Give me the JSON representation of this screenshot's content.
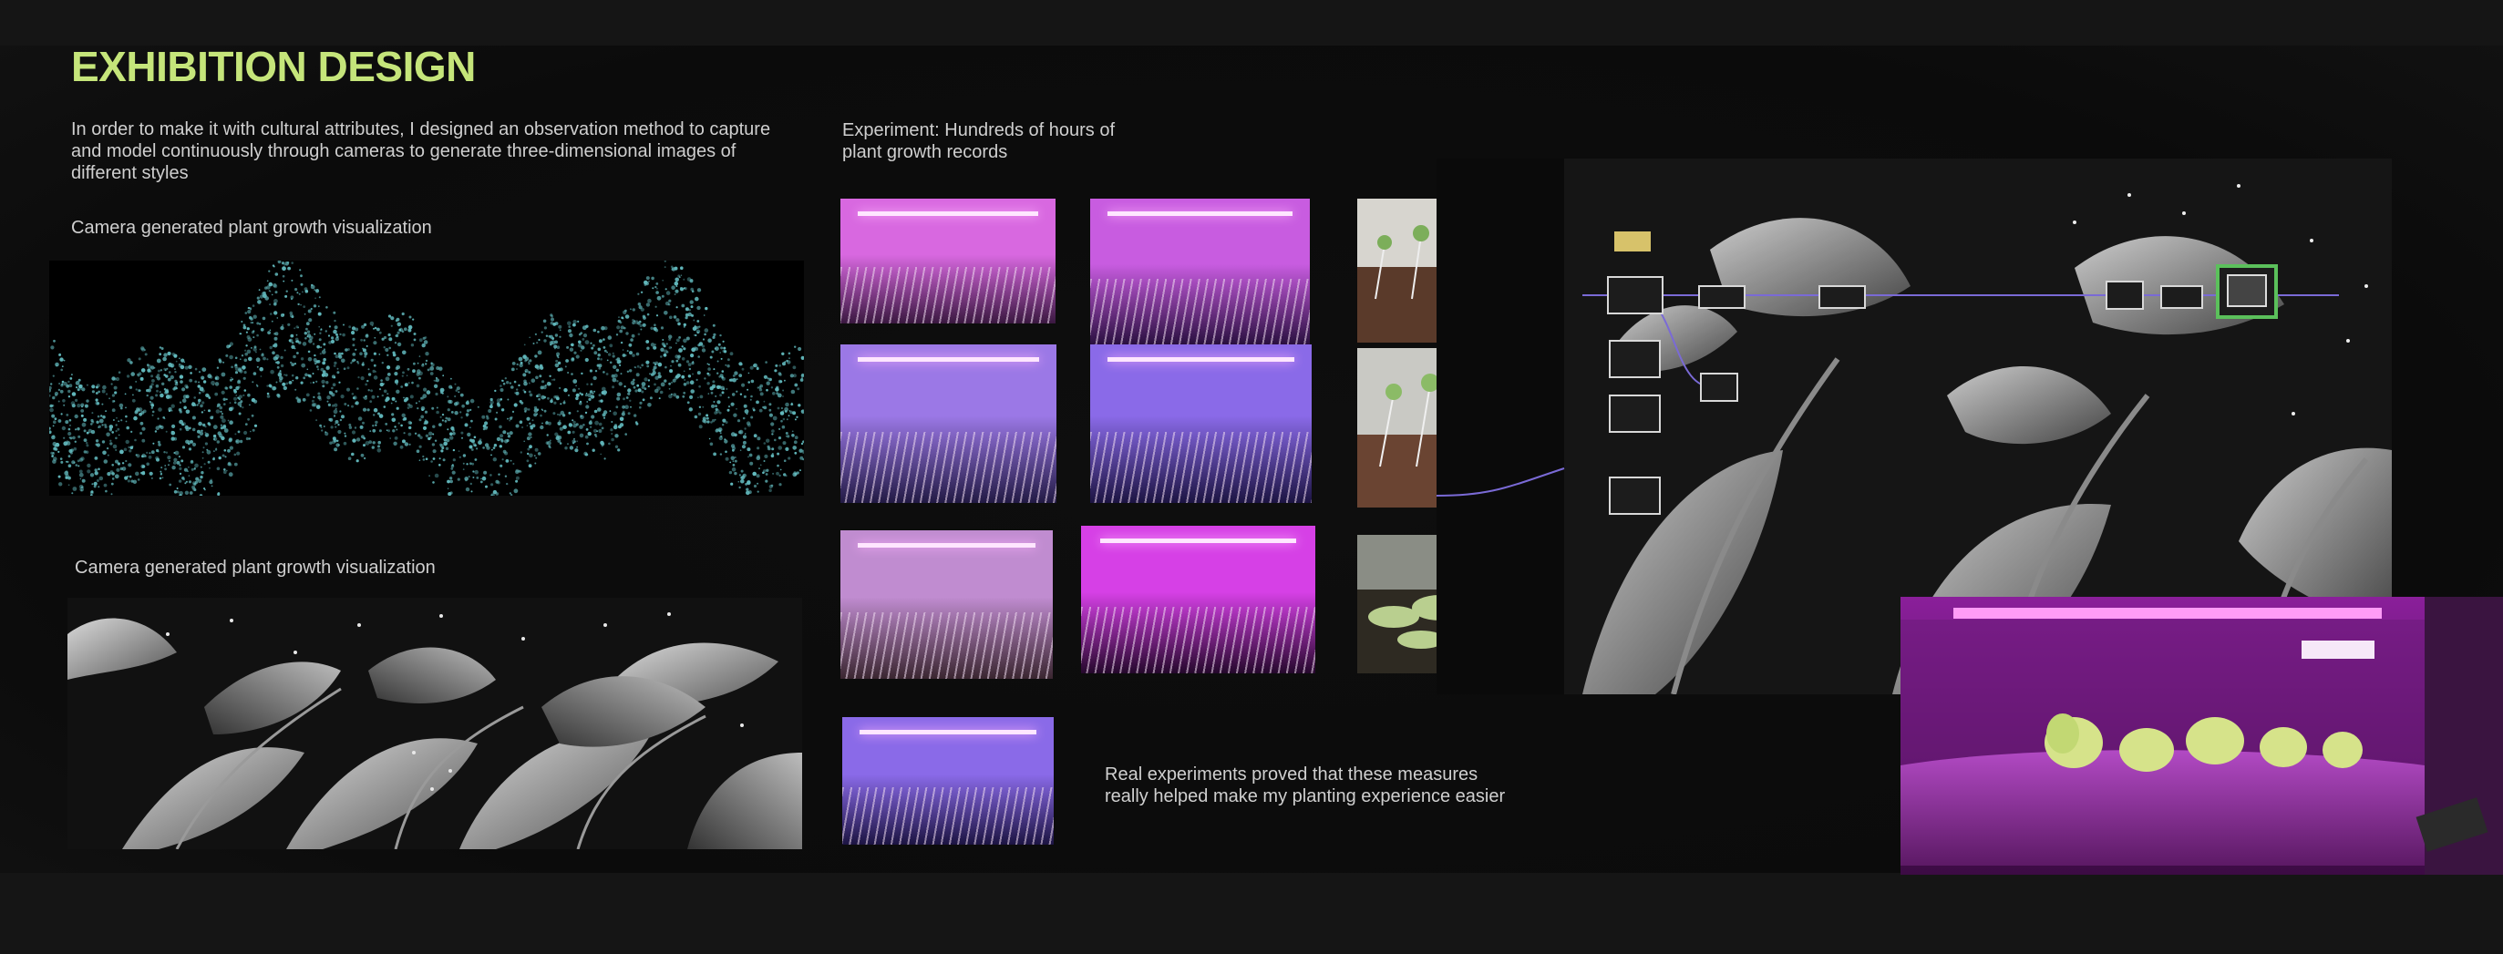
{
  "title": "EXHIBITION DESIGN",
  "intro": "In order to make it with cultural attributes, I designed an observation method to capture and model continuously through cameras to generate three-dimensional images of different styles",
  "caption_1": "Camera generated plant growth visualization",
  "caption_2": "Camera generated plant growth visualization",
  "experiment_heading": "Experiment: Hundreds of hours of plant growth records",
  "conclusion": "Real experiments proved that these measures really helped make my planting experience easier",
  "colors": {
    "accent": "#c5e57a",
    "background": "#0b0b0b",
    "point_cloud": "#62b9bd",
    "grow_light": "#c23ad6"
  }
}
